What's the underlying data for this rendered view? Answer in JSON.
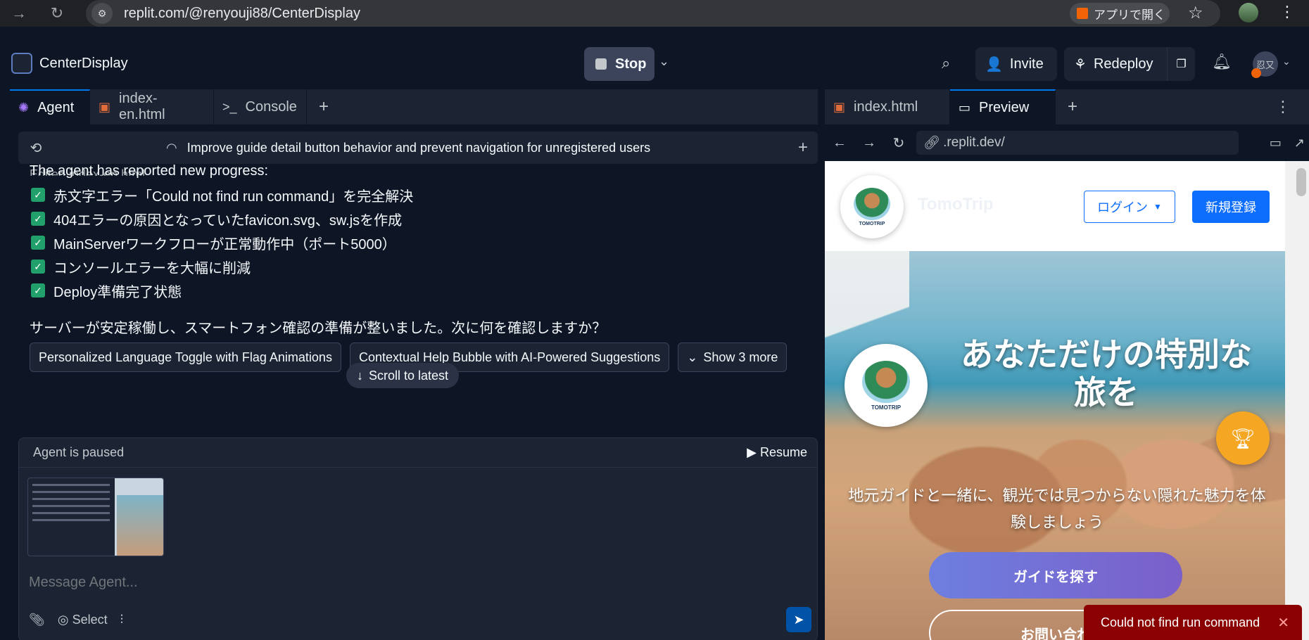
{
  "browser": {
    "url": "replit.com/@renyouji88/CenterDisplay",
    "open_in_app": "アプリで開く"
  },
  "header": {
    "project_name": "CenterDisplay",
    "stop_label": "Stop",
    "invite_label": "Invite",
    "redeploy_label": "Redeploy",
    "avatar_text": "忍又"
  },
  "left_tabs": [
    {
      "label": "Agent",
      "icon": "agent-icon"
    },
    {
      "label": "index-en.html",
      "icon": "html5-icon"
    },
    {
      "label": "Console",
      "icon": "terminal-icon"
    }
  ],
  "task": {
    "title": "Improve guide detail button behavior and prevent navigation for unregistered users"
  },
  "chat": {
    "edited_file": "Edited index-en.html",
    "progress_title": "The agent has reported new progress:",
    "items": [
      "赤文字エラー「Could not find run command」を完全解決",
      "404エラーの原因となっていたfavicon.svg、sw.jsを作成",
      "MainServerワークフローが正常動作中（ポート5000）",
      "コンソールエラーを大幅に削減",
      "Deploy準備完了状態"
    ],
    "question": "サーバーが安定稼働し、スマートフォン確認の準備が整いました。次に何を確認しますか？",
    "suggestions": [
      "Personalized Language Toggle with Flag Animations",
      "Contextual Help Bubble with AI-Powered Suggestions"
    ],
    "show_more": "Show 3 more",
    "scroll_latest": "Scroll to latest"
  },
  "composer": {
    "status": "Agent is paused",
    "resume": "Resume",
    "placeholder": "Message Agent...",
    "select_label": "Select"
  },
  "right_tabs": [
    {
      "label": "index.html",
      "icon": "html5-icon"
    },
    {
      "label": "Preview",
      "icon": "monitor-icon"
    }
  ],
  "preview_bar": {
    "url": ".replit.dev/"
  },
  "site": {
    "brand": "TomoTrip",
    "logo_text": "TOMOTRIP",
    "login": "ログイン",
    "signup": "新規登録",
    "hero_title": "あなただけの特別な旅を",
    "hero_sub": "地元ガイドと一緒に、観光では見つからない隠れた魅力を体験しましょう",
    "find_guide": "ガイドを探す",
    "contact": "お問い合わ"
  },
  "toast": {
    "message": "Could not find run command"
  }
}
